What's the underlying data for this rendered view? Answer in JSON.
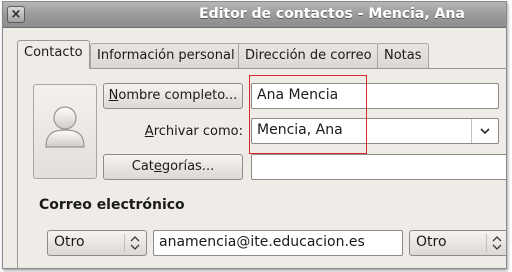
{
  "window": {
    "title": "Editor de contactos - Mencia, Ana",
    "close_glyph": "×"
  },
  "tabs": [
    {
      "label": "Contacto",
      "active": true
    },
    {
      "label": "Información personal",
      "active": false
    },
    {
      "label": "Dirección de correo",
      "active": false
    },
    {
      "label": "Notas",
      "active": false
    }
  ],
  "contact": {
    "full_name_button": {
      "pre": "",
      "mnemonic": "N",
      "post": "ombre completo..."
    },
    "full_name_value": "Ana Mencia",
    "file_as_label": {
      "pre": "",
      "mnemonic": "A",
      "post": "rchivar como:"
    },
    "file_as_value": "Mencia, Ana",
    "categories_button": {
      "pre": "Cat",
      "mnemonic": "e",
      "post": "gorías..."
    },
    "categories_value": ""
  },
  "email_section": {
    "title": "Correo electrónico",
    "type_1": "Otro",
    "address_1": "anamencia@ite.educacion.es",
    "type_2": "Otro"
  },
  "colors": {
    "highlight": "#d62b2b"
  }
}
